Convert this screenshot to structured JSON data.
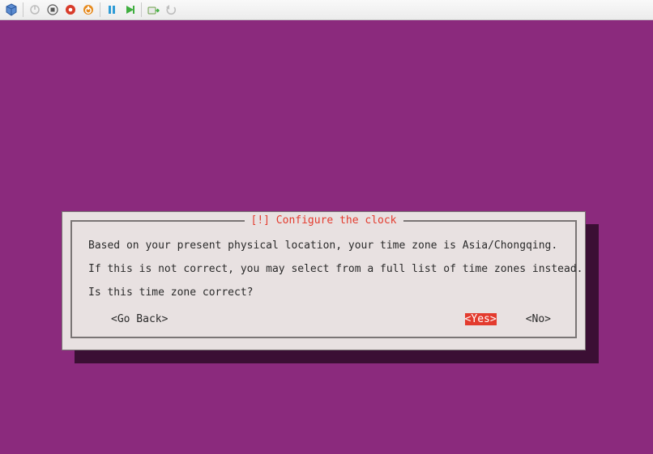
{
  "toolbar": {
    "icons": {
      "settings": "settings-cube-icon",
      "power_on": "power-on-icon",
      "stop": "stop-icon",
      "reset": "reset-icon",
      "power_off": "power-off-icon",
      "pause": "pause-icon",
      "play": "play-icon",
      "snapshot": "snapshot-icon",
      "undo": "undo-icon"
    }
  },
  "dialog": {
    "title": "[!] Configure the clock",
    "line1": "Based on your present physical location, your time zone is Asia/Chongqing.",
    "line2": "If this is not correct, you may select from a full list of time zones instead.",
    "line3": "Is this time zone correct?",
    "buttons": {
      "go_back": "<Go Back>",
      "yes": "<Yes>",
      "no": "<No>"
    },
    "selected": "yes"
  },
  "colors": {
    "background": "#8b2a7d",
    "dialog_bg": "#e8e1e1",
    "accent": "#e33b2e"
  }
}
